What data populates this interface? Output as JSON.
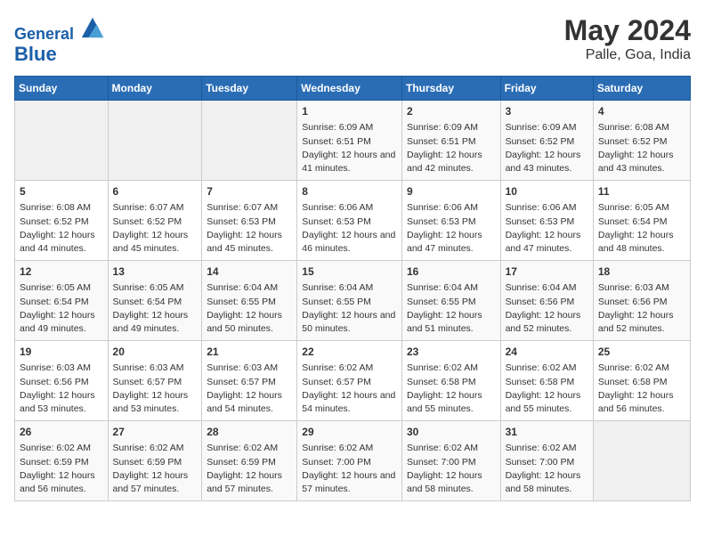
{
  "header": {
    "logo_line1": "General",
    "logo_line2": "Blue",
    "title": "May 2024",
    "subtitle": "Palle, Goa, India"
  },
  "weekdays": [
    "Sunday",
    "Monday",
    "Tuesday",
    "Wednesday",
    "Thursday",
    "Friday",
    "Saturday"
  ],
  "weeks": [
    [
      {
        "day": "",
        "sunrise": "",
        "sunset": "",
        "daylight": "",
        "empty": true
      },
      {
        "day": "",
        "sunrise": "",
        "sunset": "",
        "daylight": "",
        "empty": true
      },
      {
        "day": "",
        "sunrise": "",
        "sunset": "",
        "daylight": "",
        "empty": true
      },
      {
        "day": "1",
        "sunrise": "Sunrise: 6:09 AM",
        "sunset": "Sunset: 6:51 PM",
        "daylight": "Daylight: 12 hours and 41 minutes."
      },
      {
        "day": "2",
        "sunrise": "Sunrise: 6:09 AM",
        "sunset": "Sunset: 6:51 PM",
        "daylight": "Daylight: 12 hours and 42 minutes."
      },
      {
        "day": "3",
        "sunrise": "Sunrise: 6:09 AM",
        "sunset": "Sunset: 6:52 PM",
        "daylight": "Daylight: 12 hours and 43 minutes."
      },
      {
        "day": "4",
        "sunrise": "Sunrise: 6:08 AM",
        "sunset": "Sunset: 6:52 PM",
        "daylight": "Daylight: 12 hours and 43 minutes."
      }
    ],
    [
      {
        "day": "5",
        "sunrise": "Sunrise: 6:08 AM",
        "sunset": "Sunset: 6:52 PM",
        "daylight": "Daylight: 12 hours and 44 minutes."
      },
      {
        "day": "6",
        "sunrise": "Sunrise: 6:07 AM",
        "sunset": "Sunset: 6:52 PM",
        "daylight": "Daylight: 12 hours and 45 minutes."
      },
      {
        "day": "7",
        "sunrise": "Sunrise: 6:07 AM",
        "sunset": "Sunset: 6:53 PM",
        "daylight": "Daylight: 12 hours and 45 minutes."
      },
      {
        "day": "8",
        "sunrise": "Sunrise: 6:06 AM",
        "sunset": "Sunset: 6:53 PM",
        "daylight": "Daylight: 12 hours and 46 minutes."
      },
      {
        "day": "9",
        "sunrise": "Sunrise: 6:06 AM",
        "sunset": "Sunset: 6:53 PM",
        "daylight": "Daylight: 12 hours and 47 minutes."
      },
      {
        "day": "10",
        "sunrise": "Sunrise: 6:06 AM",
        "sunset": "Sunset: 6:53 PM",
        "daylight": "Daylight: 12 hours and 47 minutes."
      },
      {
        "day": "11",
        "sunrise": "Sunrise: 6:05 AM",
        "sunset": "Sunset: 6:54 PM",
        "daylight": "Daylight: 12 hours and 48 minutes."
      }
    ],
    [
      {
        "day": "12",
        "sunrise": "Sunrise: 6:05 AM",
        "sunset": "Sunset: 6:54 PM",
        "daylight": "Daylight: 12 hours and 49 minutes."
      },
      {
        "day": "13",
        "sunrise": "Sunrise: 6:05 AM",
        "sunset": "Sunset: 6:54 PM",
        "daylight": "Daylight: 12 hours and 49 minutes."
      },
      {
        "day": "14",
        "sunrise": "Sunrise: 6:04 AM",
        "sunset": "Sunset: 6:55 PM",
        "daylight": "Daylight: 12 hours and 50 minutes."
      },
      {
        "day": "15",
        "sunrise": "Sunrise: 6:04 AM",
        "sunset": "Sunset: 6:55 PM",
        "daylight": "Daylight: 12 hours and 50 minutes."
      },
      {
        "day": "16",
        "sunrise": "Sunrise: 6:04 AM",
        "sunset": "Sunset: 6:55 PM",
        "daylight": "Daylight: 12 hours and 51 minutes."
      },
      {
        "day": "17",
        "sunrise": "Sunrise: 6:04 AM",
        "sunset": "Sunset: 6:56 PM",
        "daylight": "Daylight: 12 hours and 52 minutes."
      },
      {
        "day": "18",
        "sunrise": "Sunrise: 6:03 AM",
        "sunset": "Sunset: 6:56 PM",
        "daylight": "Daylight: 12 hours and 52 minutes."
      }
    ],
    [
      {
        "day": "19",
        "sunrise": "Sunrise: 6:03 AM",
        "sunset": "Sunset: 6:56 PM",
        "daylight": "Daylight: 12 hours and 53 minutes."
      },
      {
        "day": "20",
        "sunrise": "Sunrise: 6:03 AM",
        "sunset": "Sunset: 6:57 PM",
        "daylight": "Daylight: 12 hours and 53 minutes."
      },
      {
        "day": "21",
        "sunrise": "Sunrise: 6:03 AM",
        "sunset": "Sunset: 6:57 PM",
        "daylight": "Daylight: 12 hours and 54 minutes."
      },
      {
        "day": "22",
        "sunrise": "Sunrise: 6:02 AM",
        "sunset": "Sunset: 6:57 PM",
        "daylight": "Daylight: 12 hours and 54 minutes."
      },
      {
        "day": "23",
        "sunrise": "Sunrise: 6:02 AM",
        "sunset": "Sunset: 6:58 PM",
        "daylight": "Daylight: 12 hours and 55 minutes."
      },
      {
        "day": "24",
        "sunrise": "Sunrise: 6:02 AM",
        "sunset": "Sunset: 6:58 PM",
        "daylight": "Daylight: 12 hours and 55 minutes."
      },
      {
        "day": "25",
        "sunrise": "Sunrise: 6:02 AM",
        "sunset": "Sunset: 6:58 PM",
        "daylight": "Daylight: 12 hours and 56 minutes."
      }
    ],
    [
      {
        "day": "26",
        "sunrise": "Sunrise: 6:02 AM",
        "sunset": "Sunset: 6:59 PM",
        "daylight": "Daylight: 12 hours and 56 minutes."
      },
      {
        "day": "27",
        "sunrise": "Sunrise: 6:02 AM",
        "sunset": "Sunset: 6:59 PM",
        "daylight": "Daylight: 12 hours and 57 minutes."
      },
      {
        "day": "28",
        "sunrise": "Sunrise: 6:02 AM",
        "sunset": "Sunset: 6:59 PM",
        "daylight": "Daylight: 12 hours and 57 minutes."
      },
      {
        "day": "29",
        "sunrise": "Sunrise: 6:02 AM",
        "sunset": "Sunset: 7:00 PM",
        "daylight": "Daylight: 12 hours and 57 minutes."
      },
      {
        "day": "30",
        "sunrise": "Sunrise: 6:02 AM",
        "sunset": "Sunset: 7:00 PM",
        "daylight": "Daylight: 12 hours and 58 minutes."
      },
      {
        "day": "31",
        "sunrise": "Sunrise: 6:02 AM",
        "sunset": "Sunset: 7:00 PM",
        "daylight": "Daylight: 12 hours and 58 minutes."
      },
      {
        "day": "",
        "sunrise": "",
        "sunset": "",
        "daylight": "",
        "empty": true
      }
    ]
  ]
}
